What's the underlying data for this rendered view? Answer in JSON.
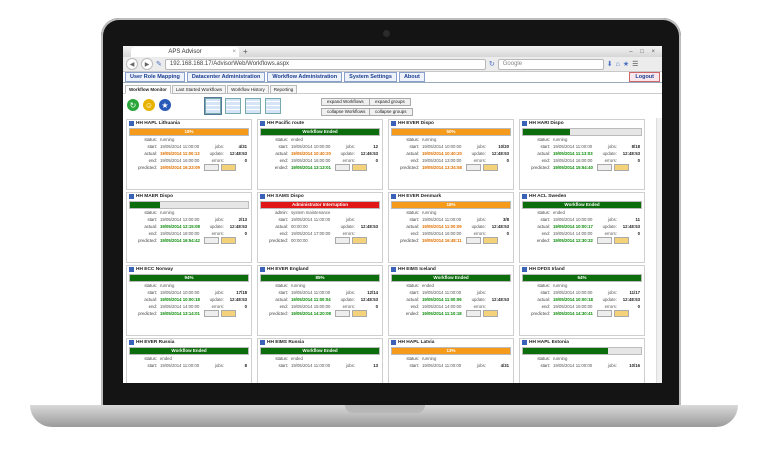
{
  "browser": {
    "tab_title": "APS Advisor",
    "tab_close": "×",
    "new_tab": "+",
    "url": "192.168.168.17/AdvisorWeb/Workflows.aspx",
    "search_placeholder": "Google",
    "window_controls": "– □ ×"
  },
  "menu": {
    "items": [
      "User Role Mapping",
      "Datacenter Administration",
      "Workflow Administration",
      "System Settings",
      "About"
    ],
    "logout": "Logout"
  },
  "subtabs": {
    "items": [
      "Workflow Monitor",
      "Last Started Workflows",
      "Workflow History",
      "Reporting"
    ],
    "active": 0
  },
  "toolbar": {
    "expand_workflows": "expand Workflows",
    "expand_groups": "expand groups",
    "collapse_workflows": "collapse Workflows",
    "collapse_groups": "collapse groups"
  },
  "colors": {
    "green": "#0c6d0c",
    "orange": "#f59a1a",
    "red": "#e01818"
  },
  "cards": [
    {
      "title": "HH HAPL Lithuania",
      "bar_text": "18%",
      "bar_color": "orange",
      "bar_fill": 1.0,
      "status_label": "status:",
      "status": "running",
      "start_label": "start:",
      "start": "19/05/2014 11:00:00",
      "jobs_label": "jobs:",
      "jobs": "4/31",
      "actual_label": "actual:",
      "actual": "19/05/2014 11:00:13",
      "actual_color": "orange",
      "update_label": "update:",
      "update": "12:48:53",
      "end_label": "end:",
      "end": "19/05/2014 16:00:00",
      "errors_label": "errors:",
      "errors": "0",
      "predicted_label": "predicted:",
      "predicted": "19/05/2014 16:23:09",
      "predicted_color": "orange"
    },
    {
      "title": "HH Pacific route",
      "bar_text": "Workflow Ended",
      "bar_color": "green",
      "bar_fill": 1.0,
      "status_label": "status:",
      "status": "ended",
      "start_label": "start:",
      "start": "19/05/2014 10:00:00",
      "jobs_label": "jobs:",
      "jobs": "12",
      "actual_label": "actual:",
      "actual": "19/05/2014 10:40:20",
      "actual_color": "orange",
      "update_label": "update:",
      "update": "12:46:53",
      "end_label": "end:",
      "end": "19/05/2014 16:00:00",
      "errors_label": "errors:",
      "errors": "0",
      "predicted_label": "ended:",
      "predicted": "19/05/2014 13:13:01",
      "predicted_color": "green"
    },
    {
      "title": "HH EVER Dispo",
      "bar_text": "50%",
      "bar_color": "orange",
      "bar_fill": 1.0,
      "status_label": "status:",
      "status": "running",
      "start_label": "start:",
      "start": "19/05/2014 10:00:00",
      "jobs_label": "jobs:",
      "jobs": "10/20",
      "actual_label": "actual:",
      "actual": "19/05/2014 10:40:20",
      "actual_color": "orange",
      "update_label": "update:",
      "update": "12:48:53",
      "end_label": "end:",
      "end": "19/05/2014 13:00:00",
      "errors_label": "errors:",
      "errors": "0",
      "predicted_label": "predicted:",
      "predicted": "19/05/2014 13:34:58",
      "predicted_color": "orange"
    },
    {
      "title": "HH HARI Dispo",
      "bar_text": "",
      "bar_color": "green",
      "bar_fill": 0.4,
      "status_label": "status:",
      "status": "running",
      "start_label": "start:",
      "start": "19/05/2014 11:00:00",
      "jobs_label": "jobs:",
      "jobs": "8/18",
      "actual_label": "actual:",
      "actual": "19/05/2014 11:13:03",
      "actual_color": "green",
      "update_label": "update:",
      "update": "12:48:53",
      "end_label": "end:",
      "end": "19/05/2014 16:00:00",
      "errors_label": "errors:",
      "errors": "0",
      "predicted_label": "predicted:",
      "predicted": "19/05/2014 15:54:40",
      "predicted_color": "green"
    },
    {
      "title": "HH MAER Dispo",
      "bar_text": "",
      "bar_color": "green",
      "bar_fill": 0.25,
      "status_label": "status:",
      "status": "running",
      "start_label": "start:",
      "start": "19/05/2014 12:00:00",
      "jobs_label": "jobs:",
      "jobs": "2/13",
      "actual_label": "actual:",
      "actual": "19/05/2014 12:15:08",
      "actual_color": "green",
      "update_label": "update:",
      "update": "12:48:53",
      "end_label": "end:",
      "end": "19/05/2014 18:00:00",
      "errors_label": "errors:",
      "errors": "0",
      "predicted_label": "predicted:",
      "predicted": "19/05/2014 16:54:42",
      "predicted_color": "green"
    },
    {
      "title": "HH SAMS Dispo",
      "bar_text": "Administrator Interruption",
      "bar_color": "red",
      "bar_fill": 1.0,
      "status_label": "admin:",
      "status": "system maintenance",
      "start_label": "start:",
      "start": "19/05/2014 11:00:00",
      "jobs_label": "jobs:",
      "jobs": "",
      "actual_label": "actual:",
      "actual": "00:00:00",
      "actual_color": "dim",
      "update_label": "update:",
      "update": "12:48:53",
      "end_label": "end:",
      "end": "19/05/2014 17:00:00",
      "errors_label": "errors:",
      "errors": "",
      "predicted_label": "predicted:",
      "predicted": "00:00:00",
      "predicted_color": "dim"
    },
    {
      "title": "HH EVER Denmark",
      "bar_text": "18%",
      "bar_color": "orange",
      "bar_fill": 1.0,
      "status_label": "status:",
      "status": "running",
      "start_label": "start:",
      "start": "19/05/2014 11:00:00",
      "jobs_label": "jobs:",
      "jobs": "3/8",
      "actual_label": "actual:",
      "actual": "19/05/2014 11:00:09",
      "actual_color": "orange",
      "update_label": "update:",
      "update": "12:48:53",
      "end_label": "end:",
      "end": "19/05/2014 16:00:00",
      "errors_label": "errors:",
      "errors": "0",
      "predicted_label": "predicted:",
      "predicted": "19/05/2014 16:48:11",
      "predicted_color": "orange"
    },
    {
      "title": "HH ACL Sweden",
      "bar_text": "Workflow Ended",
      "bar_color": "green",
      "bar_fill": 1.0,
      "status_label": "status:",
      "status": "ended",
      "start_label": "start:",
      "start": "19/05/2014 10:00:00",
      "jobs_label": "jobs:",
      "jobs": "11",
      "actual_label": "actual:",
      "actual": "19/05/2014 10:00:17",
      "actual_color": "green",
      "update_label": "update:",
      "update": "12:48:53",
      "end_label": "end:",
      "end": "19/05/2014 14:00:00",
      "errors_label": "errors:",
      "errors": "0",
      "predicted_label": "ended:",
      "predicted": "19/05/2014 12:30:32",
      "predicted_color": "green"
    },
    {
      "title": "HH ECC Norway",
      "bar_text": "94%",
      "bar_color": "green",
      "bar_fill": 1.0,
      "status_label": "status:",
      "status": "running",
      "start_label": "start:",
      "start": "19/05/2014 10:00:00",
      "jobs_label": "jobs:",
      "jobs": "17/18",
      "actual_label": "actual:",
      "actual": "19/05/2014 10:00:18",
      "actual_color": "green",
      "update_label": "update:",
      "update": "12:48:53",
      "end_label": "end:",
      "end": "19/05/2014 14:00:00",
      "errors_label": "errors:",
      "errors": "0",
      "predicted_label": "predicted:",
      "predicted": "19/05/2014 13:14:01",
      "predicted_color": "green"
    },
    {
      "title": "HH EVER England",
      "bar_text": "85%",
      "bar_color": "green",
      "bar_fill": 1.0,
      "status_label": "status:",
      "status": "running",
      "start_label": "start:",
      "start": "19/05/2014 11:00:00",
      "jobs_label": "jobs:",
      "jobs": "12/14",
      "actual_label": "actual:",
      "actual": "19/05/2014 11:00:04",
      "actual_color": "green",
      "update_label": "update:",
      "update": "12:48:53",
      "end_label": "end:",
      "end": "19/05/2014 15:00:00",
      "errors_label": "errors:",
      "errors": "0",
      "predicted_label": "predicted:",
      "predicted": "19/05/2014 14:20:08",
      "predicted_color": "green"
    },
    {
      "title": "HH EIMS Iceland",
      "bar_text": "Workflow Ended",
      "bar_color": "green",
      "bar_fill": 1.0,
      "status_label": "status:",
      "status": "ended",
      "start_label": "start:",
      "start": "19/05/2014 11:00:00",
      "jobs_label": "jobs:",
      "jobs": "",
      "actual_label": "actual:",
      "actual": "19/05/2014 11:00:06",
      "actual_color": "green",
      "update_label": "update:",
      "update": "12:48:53",
      "end_label": "end:",
      "end": "19/05/2014 14:00:00",
      "errors_label": "errors:",
      "errors": "",
      "predicted_label": "ended:",
      "predicted": "19/05/2014 11:10:18",
      "predicted_color": "green"
    },
    {
      "title": "HH DFDS Irland",
      "bar_text": "64%",
      "bar_color": "green",
      "bar_fill": 1.0,
      "status_label": "status:",
      "status": "running",
      "start_label": "start:",
      "start": "19/05/2014 10:00:00",
      "jobs_label": "jobs:",
      "jobs": "11/17",
      "actual_label": "actual:",
      "actual": "19/05/2014 10:00:18",
      "actual_color": "green",
      "update_label": "update:",
      "update": "12:48:53",
      "end_label": "end:",
      "end": "19/05/2014 15:00:00",
      "errors_label": "errors:",
      "errors": "0",
      "predicted_label": "predicted:",
      "predicted": "19/05/2014 14:30:41",
      "predicted_color": "green"
    },
    {
      "title": "HH EVER Russia",
      "bar_text": "Workflow Ended",
      "bar_color": "green",
      "bar_fill": 1.0,
      "status_label": "status:",
      "status": "ended",
      "start_label": "start:",
      "start": "19/05/2014 11:00:00",
      "jobs_label": "jobs:",
      "jobs": "8",
      "actual_label": "",
      "actual": "",
      "actual_color": "dim",
      "update_label": "",
      "update": "",
      "end_label": "",
      "end": "",
      "errors_label": "",
      "errors": "",
      "predicted_label": "",
      "predicted": "",
      "predicted_color": "dim"
    },
    {
      "title": "HH EIMS Russia",
      "bar_text": "Workflow Ended",
      "bar_color": "green",
      "bar_fill": 1.0,
      "status_label": "status:",
      "status": "ended",
      "start_label": "start:",
      "start": "19/05/2014 11:00:00",
      "jobs_label": "jobs:",
      "jobs": "13",
      "actual_label": "",
      "actual": "",
      "actual_color": "dim",
      "update_label": "",
      "update": "",
      "end_label": "",
      "end": "",
      "errors_label": "",
      "errors": "",
      "predicted_label": "",
      "predicted": "",
      "predicted_color": "dim"
    },
    {
      "title": "HH HAPL Latvia",
      "bar_text": "13%",
      "bar_color": "orange",
      "bar_fill": 1.0,
      "status_label": "status:",
      "status": "running",
      "start_label": "start:",
      "start": "19/05/2014 11:00:00",
      "jobs_label": "jobs:",
      "jobs": "4/31",
      "actual_label": "",
      "actual": "",
      "actual_color": "dim",
      "update_label": "",
      "update": "",
      "end_label": "",
      "end": "",
      "errors_label": "",
      "errors": "",
      "predicted_label": "",
      "predicted": "",
      "predicted_color": "dim"
    },
    {
      "title": "HH HAPL Estonia",
      "bar_text": "",
      "bar_color": "green",
      "bar_fill": 0.72,
      "status_label": "status:",
      "status": "running",
      "start_label": "start:",
      "start": "19/05/2014 11:00:00",
      "jobs_label": "jobs:",
      "jobs": "10/16",
      "actual_label": "",
      "actual": "",
      "actual_color": "dim",
      "update_label": "",
      "update": "",
      "end_label": "",
      "end": "",
      "errors_label": "",
      "errors": "",
      "predicted_label": "",
      "predicted": "",
      "predicted_color": "dim"
    }
  ]
}
